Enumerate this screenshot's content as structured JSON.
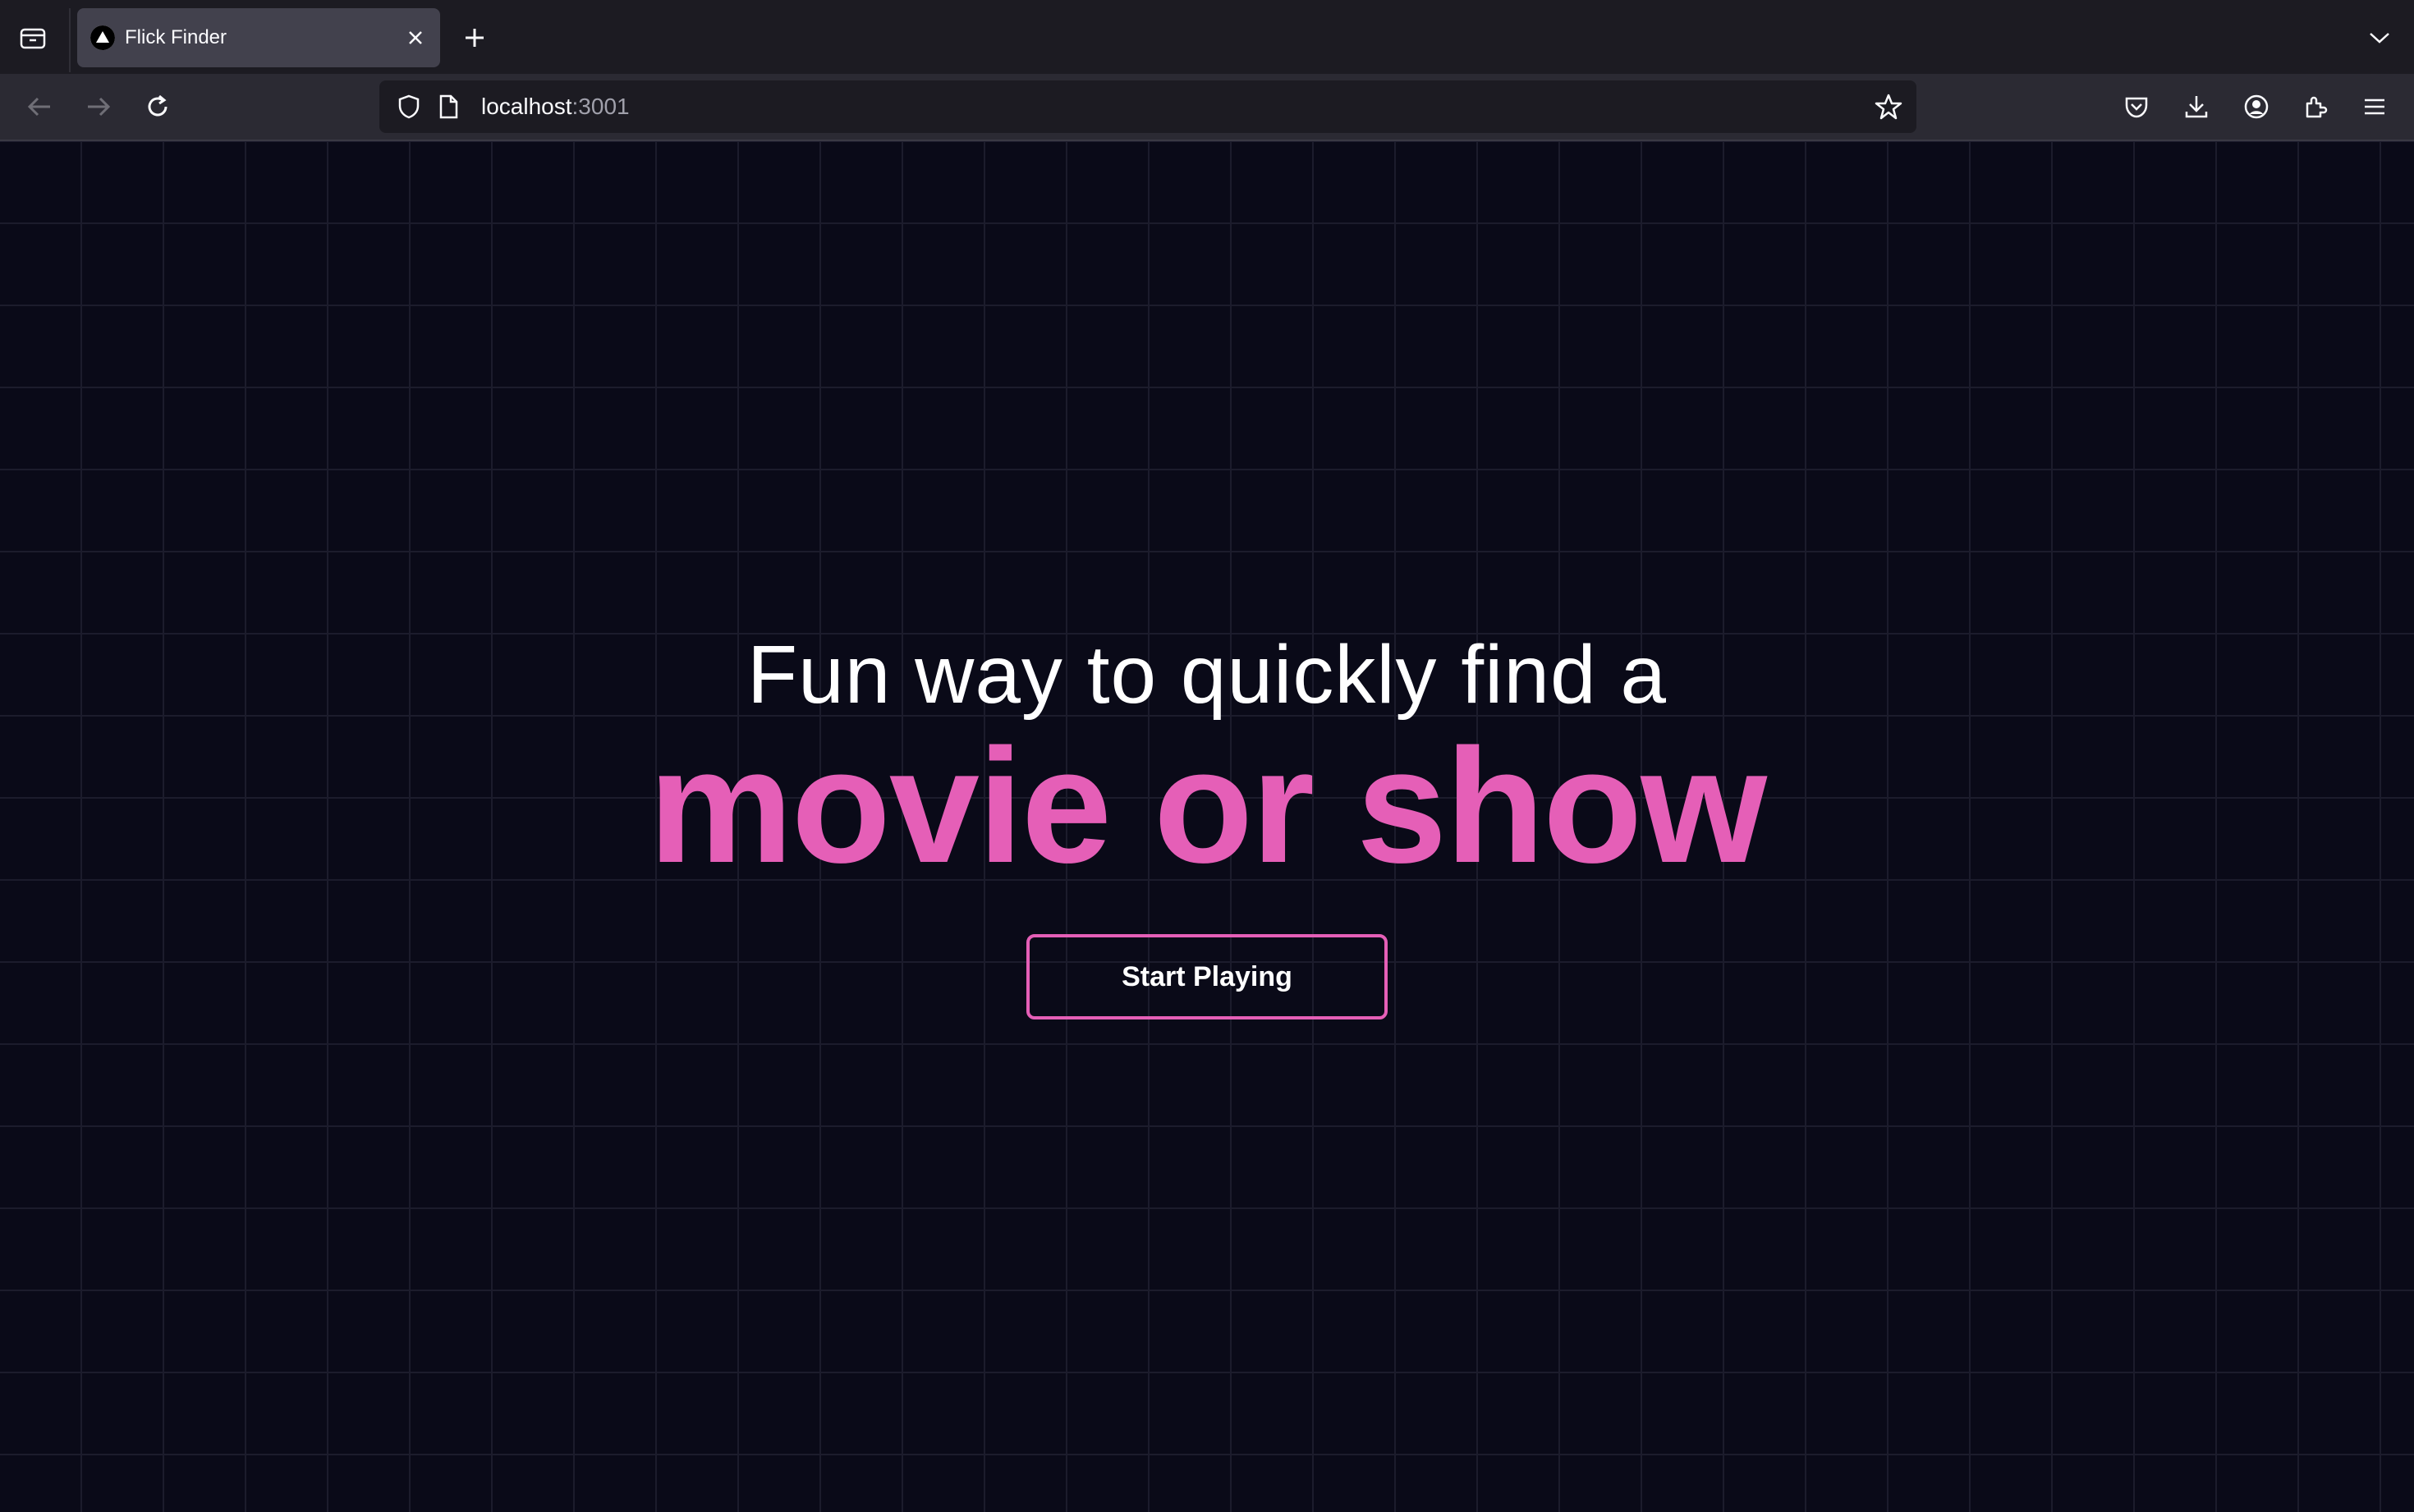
{
  "browser": {
    "tab": {
      "title": "Flick Finder"
    },
    "url": {
      "host": "localhost",
      "port": ":3001"
    }
  },
  "hero": {
    "line1": "Fun way to quickly find a",
    "line2": "movie or show",
    "cta_label": "Start Playing"
  },
  "colors": {
    "accent": "#e55fb7",
    "background": "#0a0a18",
    "grid": "#1c1c2c"
  }
}
